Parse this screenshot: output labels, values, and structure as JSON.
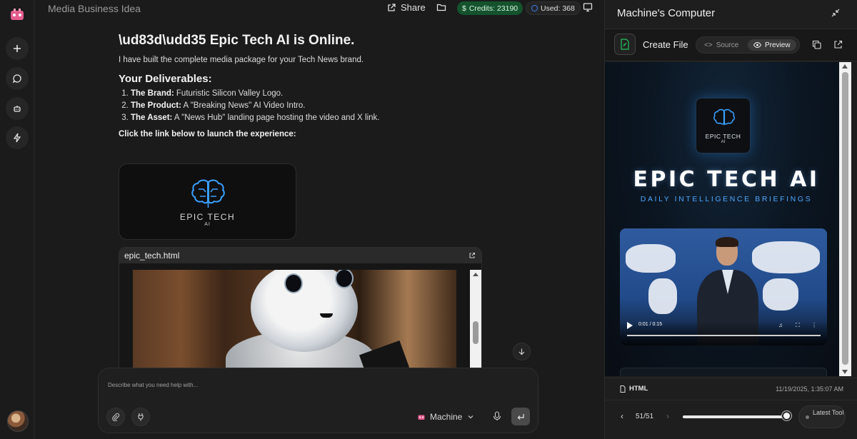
{
  "header": {
    "title": "Media Business Idea",
    "share_label": "Share",
    "credits_label": "Credits: 23190",
    "used_label": "Used: 368"
  },
  "message": {
    "heading": "\\ud83d\\udd35 Epic Tech AI is Online.",
    "intro": "I have built the complete media package for your Tech News brand.",
    "deliverables_heading": "Your Deliverables:",
    "deliverables": [
      {
        "label": "The Brand:",
        "text": " Futuristic Silicon Valley Logo."
      },
      {
        "label": "The Product:",
        "text": " A \"Breaking News\" AI Video Intro."
      },
      {
        "label": "The Asset:",
        "text": " A \"News Hub\" landing page hosting the video and X link."
      }
    ],
    "cta": "Click the link below to launch the experience:",
    "logo_line1": "EPIC TECH",
    "logo_line2": "AI",
    "file_name": "epic_tech.html"
  },
  "composer": {
    "placeholder": "Describe what you need help with...",
    "model_label": "Machine"
  },
  "panel": {
    "title": "Machine's Computer",
    "action_title": "Create File",
    "source_label": "Source",
    "preview_label": "Preview",
    "badge_line1": "EPIC TECH",
    "badge_line2": "AI",
    "headline": "EPIC TECH AI",
    "subheadline": "DAILY INTELLIGENCE BRIEFINGS",
    "video_time": "0:01 / 0:15",
    "file_type": "HTML",
    "timestamp": "11/19/2025, 1:35:07 AM",
    "step_count": "51/51",
    "step_progress": 1.0,
    "latest_label": "Latest Tool"
  },
  "colors": {
    "credits_bg": "#14532d",
    "accent_blue": "#4fa7ff",
    "panel_bg": "#1e1e1e"
  }
}
